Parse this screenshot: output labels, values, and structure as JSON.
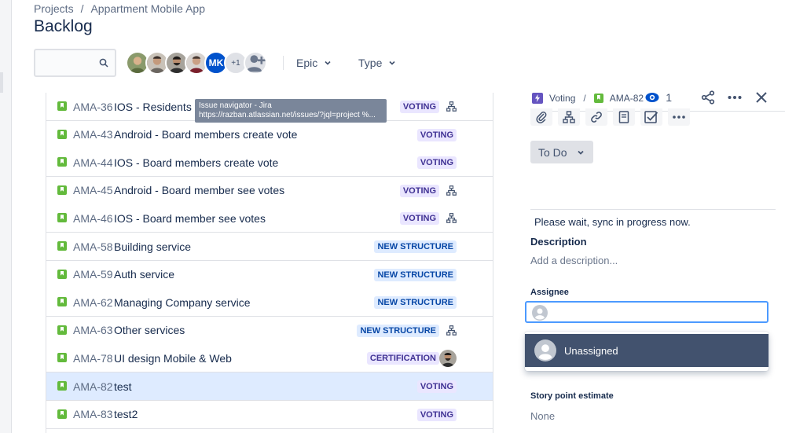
{
  "breadcrumb": {
    "root": "Projects",
    "separator": "/",
    "project": "Appartment Mobile App"
  },
  "page_title": "Backlog",
  "toolbar": {
    "search_placeholder": "",
    "avatar_initials": "MK",
    "avatar_more": "+1",
    "epic_label": "Epic",
    "type_label": "Type"
  },
  "tooltip": {
    "line1": "Issue navigator - Jira",
    "line2": "https://razban.atlassian.net/issues/?jql=project %..."
  },
  "issues": [
    {
      "key": "AMA-36",
      "summary": "IOS - Residents see",
      "epic": "VOTING",
      "epic_style": "voting",
      "has_children": true
    },
    {
      "key": "AMA-43",
      "summary": "Android - Board members create vote",
      "epic": "VOTING",
      "epic_style": "voting",
      "has_children": false
    },
    {
      "key": "AMA-44",
      "summary": "IOS - Board members create vote",
      "epic": "VOTING",
      "epic_style": "voting",
      "has_children": false
    },
    {
      "key": "AMA-45",
      "summary": "Android - Board member see votes",
      "epic": "VOTING",
      "epic_style": "voting",
      "has_children": true
    },
    {
      "key": "AMA-46",
      "summary": "IOS - Board member see votes",
      "epic": "VOTING",
      "epic_style": "voting",
      "has_children": true
    },
    {
      "key": "AMA-58",
      "summary": "Building service",
      "epic": "NEW STRUCTURE",
      "epic_style": "new",
      "has_children": false
    },
    {
      "key": "AMA-59",
      "summary": "Auth service",
      "epic": "NEW STRUCTURE",
      "epic_style": "new",
      "has_children": false
    },
    {
      "key": "AMA-62",
      "summary": "Managing Company service",
      "epic": "NEW STRUCTURE",
      "epic_style": "new",
      "has_children": false
    },
    {
      "key": "AMA-63",
      "summary": "Other services",
      "epic": "NEW STRUCTURE",
      "epic_style": "new",
      "has_children": true
    },
    {
      "key": "AMA-78",
      "summary": "UI design Mobile & Web",
      "epic": "CERTIFICATION",
      "epic_style": "cert",
      "has_children": false,
      "has_assignee": true
    },
    {
      "key": "AMA-82",
      "summary": "test",
      "epic": "VOTING",
      "epic_style": "voting",
      "has_children": false,
      "selected": true
    },
    {
      "key": "AMA-83",
      "summary": "test2",
      "epic": "VOTING",
      "epic_style": "voting",
      "has_children": false
    }
  ],
  "detail": {
    "epic_name": "Voting",
    "separator": "/",
    "issue_key": "AMA-82",
    "watch_count": "1",
    "status": "To Do",
    "sync_message": "Please wait, sync in progress now.",
    "description_label": "Description",
    "description_placeholder": "Add a description...",
    "assignee_label": "Assignee",
    "assignee_value": "",
    "assignee_option": "Unassigned",
    "story_point_label": "Story point estimate",
    "story_point_value": "None"
  },
  "colors": {
    "story": "#63ba3c",
    "epic": "#6554c0",
    "selected_row": "#deebff",
    "focus": "#4c9aff",
    "dropdown_highlight": "#42526e"
  }
}
